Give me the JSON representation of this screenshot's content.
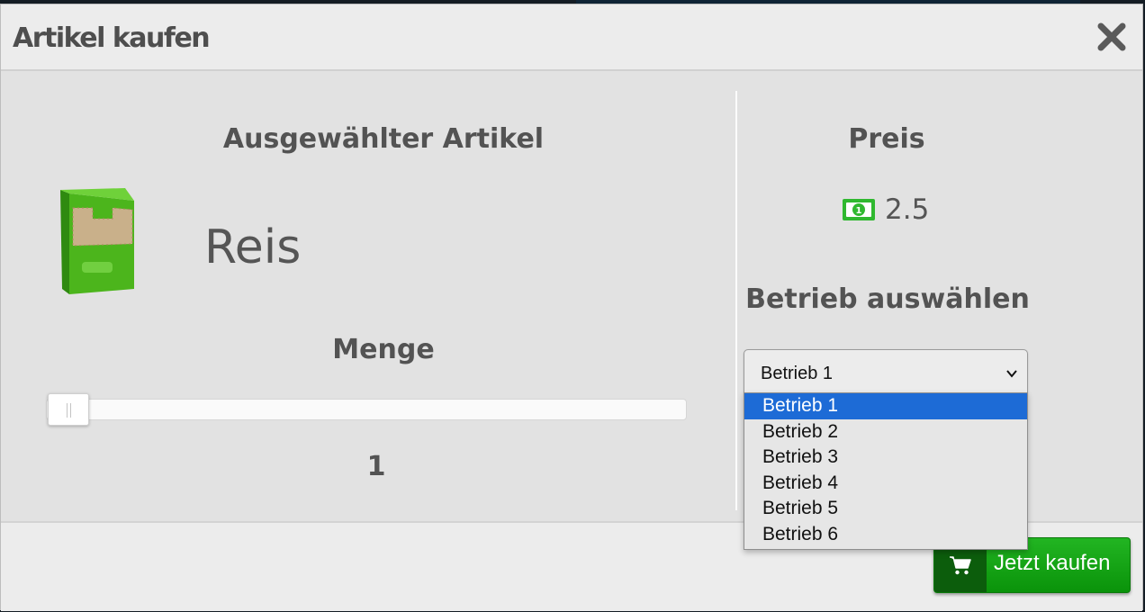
{
  "modal": {
    "title": "Artikel kaufen",
    "close_icon": "close-icon"
  },
  "article": {
    "section_title": "Ausgewählter Artikel",
    "name": "Reis",
    "image_icon": "rice-package-icon"
  },
  "quantity": {
    "section_title": "Menge",
    "value": "1",
    "slider_level": 0
  },
  "price": {
    "section_title": "Preis",
    "value": "2.5",
    "icon": "money-bill-icon",
    "icon_color": "#2fb82f"
  },
  "business": {
    "section_title": "Betrieb auswählen",
    "selected": "Betrieb 1",
    "options": [
      "Betrieb 1",
      "Betrieb 2",
      "Betrieb 3",
      "Betrieb 4",
      "Betrieb 5",
      "Betrieb 6"
    ],
    "highlight_color": "#1d6bd6"
  },
  "footer": {
    "buy_label": "Jetzt kaufen",
    "buy_icon": "cart-icon",
    "buy_color": "#14a314"
  }
}
